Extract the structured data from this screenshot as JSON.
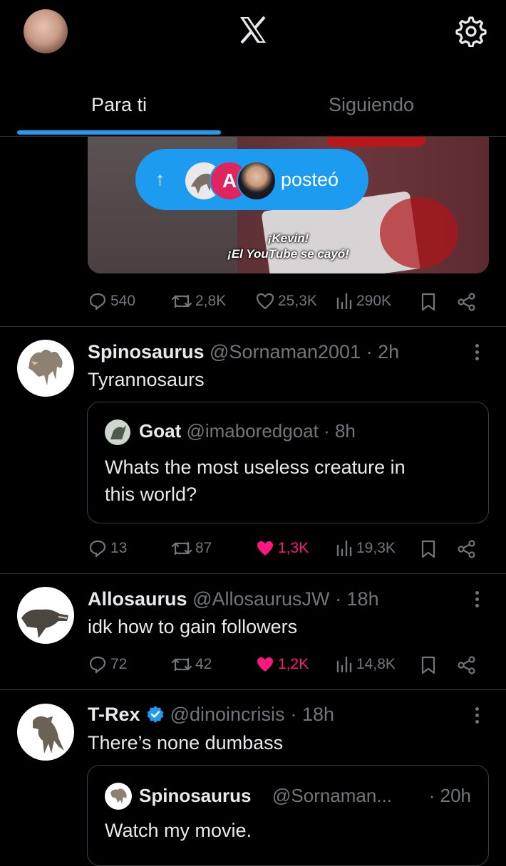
{
  "header": {
    "logo": "𝕏",
    "profile_avatar_icon": "profile-photo",
    "settings_icon": "gear-icon"
  },
  "tabs": [
    {
      "label": "Para ti",
      "active": true
    },
    {
      "label": "Siguiendo",
      "active": false
    }
  ],
  "pill": {
    "label": "posteó",
    "arrow": "↑"
  },
  "video_caption": {
    "line1": "¡Kevin!",
    "line2": "¡El YouTube se cayó!"
  },
  "post0": {
    "replies": "540",
    "reposts": "2,8K",
    "likes": "25,3K",
    "views": "290K",
    "liked": false
  },
  "post1": {
    "name": "Spinosaurus",
    "handle": "@Sornaman2001",
    "time": "· 2h",
    "text": "Tyrannosaurs",
    "quote": {
      "name": "Goat",
      "handle": "@imaboredgoat",
      "time": "· 8h",
      "text_line1": "Whats the most useless creature in",
      "text_line2": "this world?"
    },
    "replies": "13",
    "reposts": "87",
    "likes": "1,3K",
    "views": "19,3K",
    "liked": true
  },
  "post2": {
    "name": "Allosaurus",
    "handle": "@AllosaurusJW",
    "time": "· 18h",
    "text": "idk how to gain followers",
    "replies": "72",
    "reposts": "42",
    "likes": "1,2K",
    "views": "14,8K",
    "liked": true
  },
  "post3": {
    "name": "T-Rex",
    "handle": "@dinoincrisis",
    "time": "· 18h",
    "verified": true,
    "text": "There’s none dumbass",
    "quote": {
      "name": "Spinosaurus",
      "handle": "@Sornaman...",
      "time": "· 20h",
      "text": "Watch my movie."
    }
  },
  "colors": {
    "accent": "#1d9bf0",
    "like": "#f91880",
    "muted": "#71767b",
    "verified": "#1d9bf0"
  }
}
